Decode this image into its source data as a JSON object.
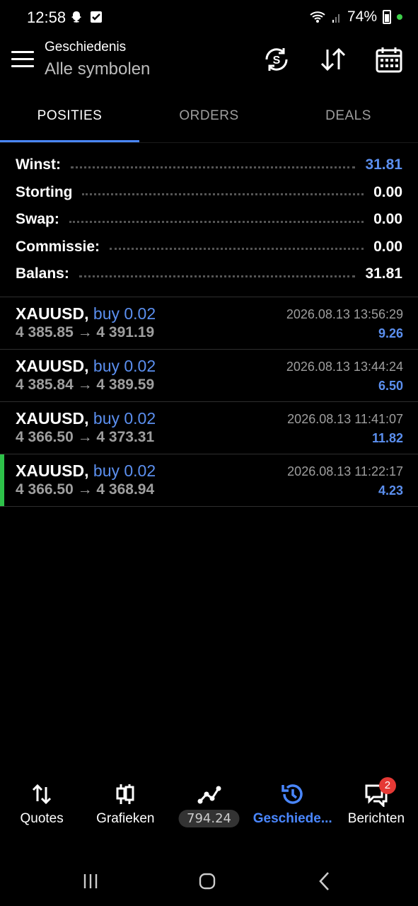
{
  "status": {
    "time": "12:58",
    "battery": "74%"
  },
  "toolbar": {
    "subtitle": "Geschiedenis",
    "title": "Alle symbolen"
  },
  "tabs": [
    {
      "label": "POSITIES",
      "active": true
    },
    {
      "label": "ORDERS",
      "active": false
    },
    {
      "label": "DEALS",
      "active": false
    }
  ],
  "summary": [
    {
      "label": "Winst:",
      "value": "31.81"
    },
    {
      "label": "Storting",
      "value": "0.00"
    },
    {
      "label": "Swap:",
      "value": "0.00"
    },
    {
      "label": "Commissie:",
      "value": "0.00"
    },
    {
      "label": "Balans:",
      "value": "31.81"
    }
  ],
  "positions": [
    {
      "symbol": "XAUUSD,",
      "side": "buy 0.02",
      "prices": "4 385.85 → 4 391.19",
      "time": "2026.08.13 13:56:29",
      "profit": "9.26"
    },
    {
      "symbol": "XAUUSD,",
      "side": "buy 0.02",
      "prices": "4 385.84 → 4 389.59",
      "time": "2026.08.13 13:44:24",
      "profit": "6.50"
    },
    {
      "symbol": "XAUUSD,",
      "side": "buy 0.02",
      "prices": "4 366.50 → 4 373.31",
      "time": "2026.08.13 11:41:07",
      "profit": "11.82"
    },
    {
      "symbol": "XAUUSD,",
      "side": "buy 0.02",
      "prices": "4 366.50 → 4 368.94",
      "time": "2026.08.13 11:22:17",
      "profit": "4.23"
    }
  ],
  "bottom_nav": {
    "quotes": "Quotes",
    "charts": "Grafieken",
    "trade_value": "794.24",
    "history": "Geschiede...",
    "messages": "Berichten",
    "messages_badge": "2"
  },
  "colors": {
    "accent": "#4a87ff",
    "profit": "#5b8fef",
    "marker": "#2ec24a",
    "badge": "#e53935"
  }
}
